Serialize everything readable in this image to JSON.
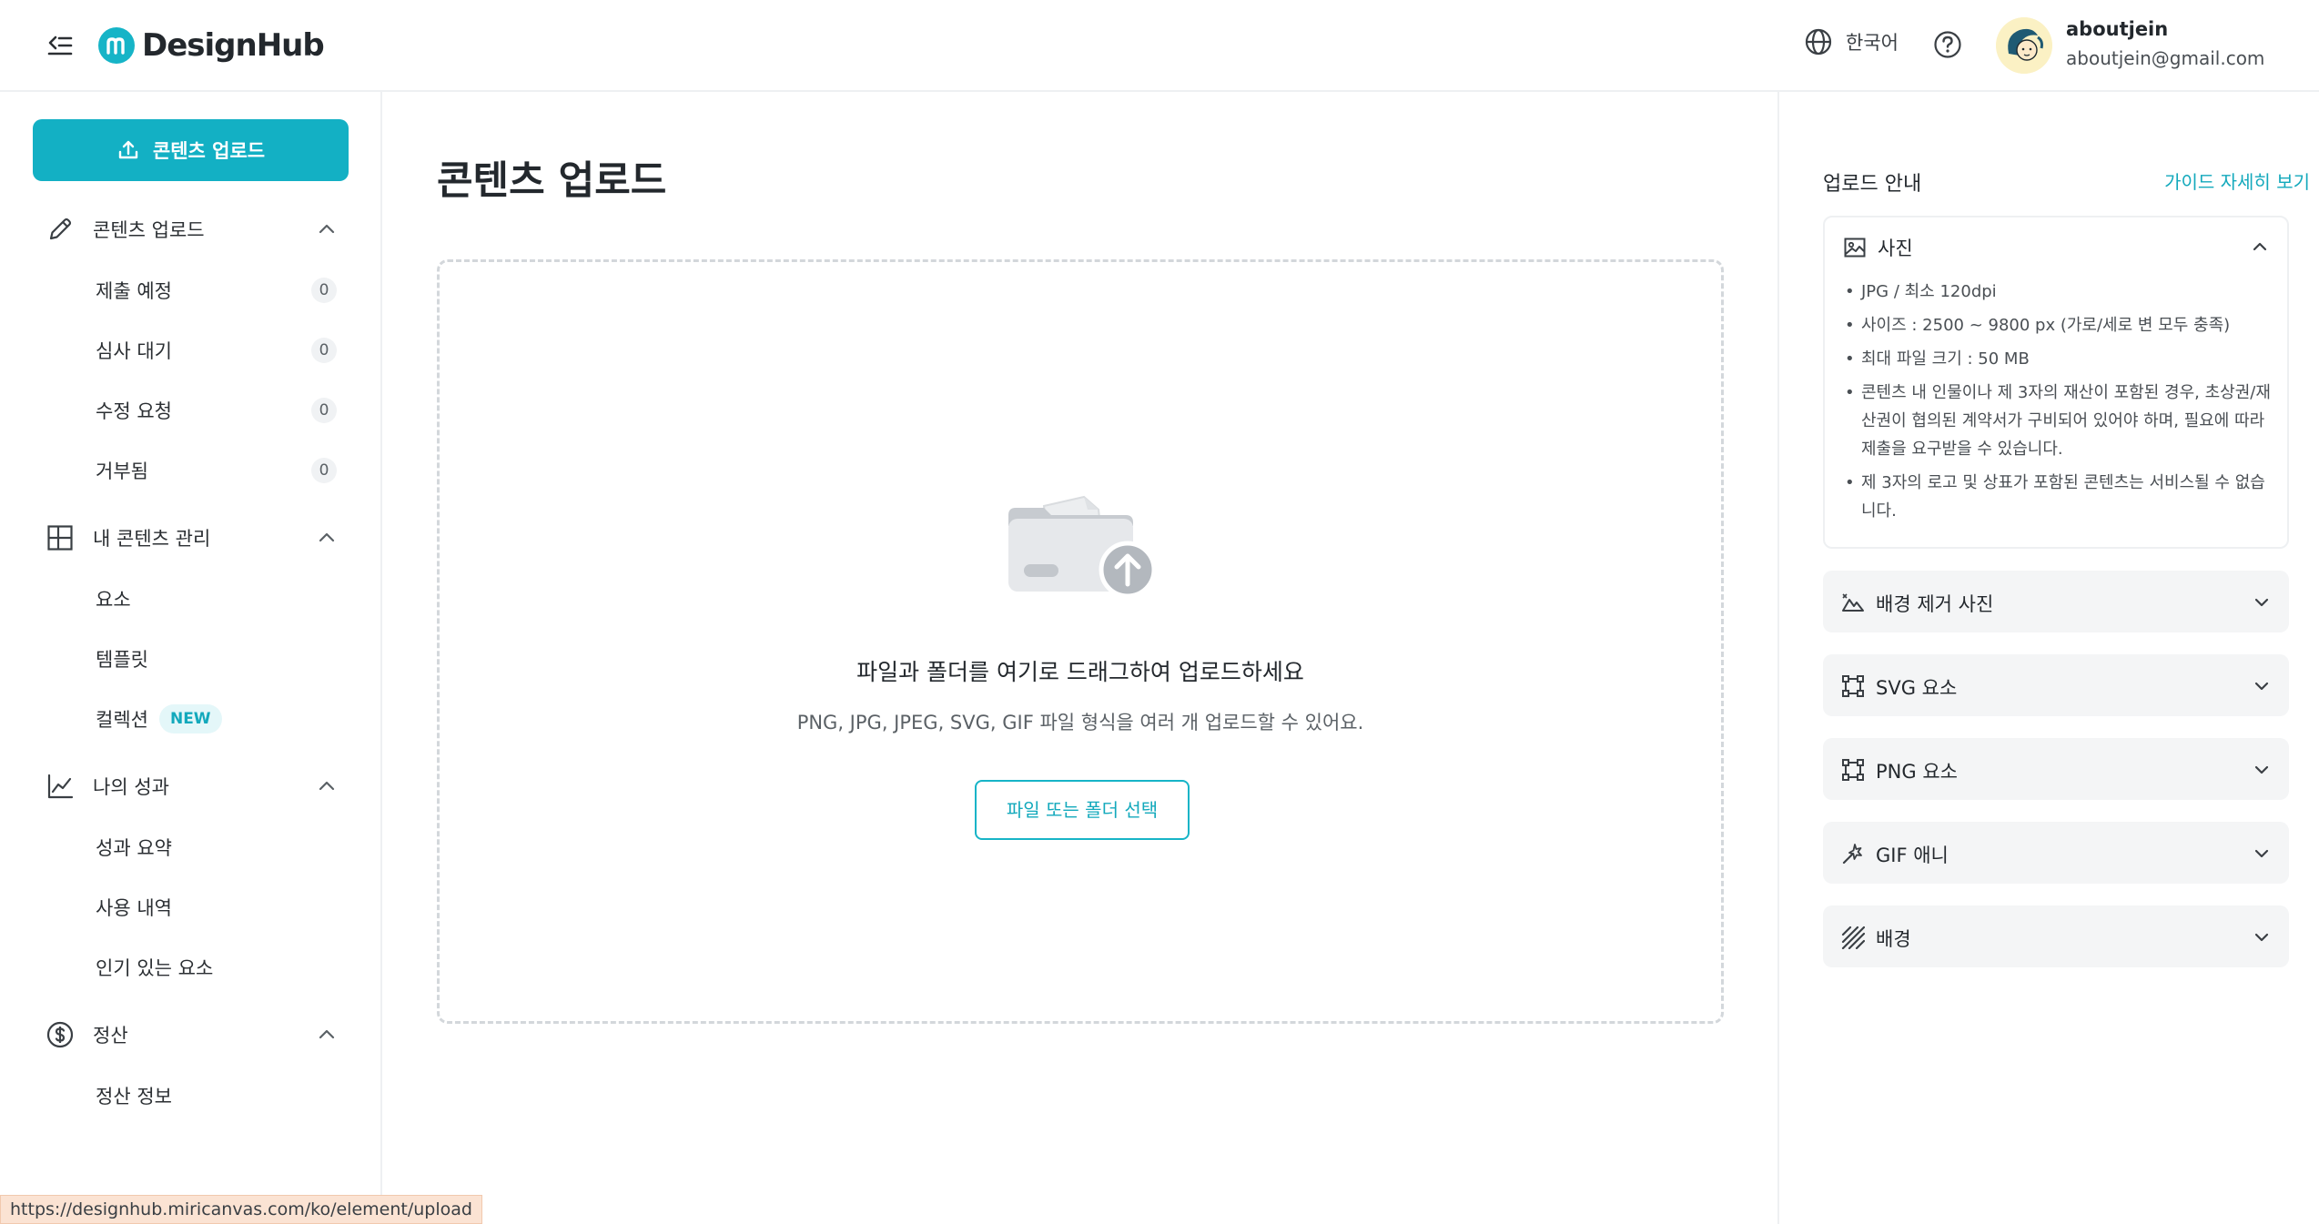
{
  "header": {
    "logo_text": "DesignHub",
    "language": "한국어",
    "user_name": "aboutjein",
    "user_email": "aboutjein@gmail.com"
  },
  "sidebar": {
    "upload_button": "콘텐츠 업로드",
    "sections": [
      {
        "label": "콘텐츠 업로드",
        "icon": "pencil-icon",
        "items": [
          {
            "label": "제출 예정",
            "count": "0"
          },
          {
            "label": "심사 대기",
            "count": "0"
          },
          {
            "label": "수정 요청",
            "count": "0"
          },
          {
            "label": "거부됨",
            "count": "0"
          }
        ]
      },
      {
        "label": "내 콘텐츠 관리",
        "icon": "layout-grid-icon",
        "items": [
          {
            "label": "요소"
          },
          {
            "label": "템플릿"
          },
          {
            "label": "컬렉션",
            "badge": "NEW"
          }
        ]
      },
      {
        "label": "나의 성과",
        "icon": "line-chart-icon",
        "items": [
          {
            "label": "성과 요약"
          },
          {
            "label": "사용 내역"
          },
          {
            "label": "인기 있는 요소"
          }
        ]
      },
      {
        "label": "정산",
        "icon": "coin-icon",
        "items": [
          {
            "label": "정산 정보"
          }
        ]
      }
    ]
  },
  "main": {
    "title": "콘텐츠 업로드",
    "drop_title": "파일과 폴더를 여기로 드래그하여 업로드하세요",
    "drop_subtitle": "PNG, JPG, JPEG, SVG, GIF 파일 형식을 여러 개 업로드할 수 있어요.",
    "select_button": "파일 또는 폴더 선택"
  },
  "guide": {
    "title": "업로드 안내",
    "link": "가이드 자세히 보기",
    "open_section": {
      "label": "사진",
      "icon": "image-icon",
      "bullets": [
        "JPG / 최소 120dpi",
        "사이즈 : 2500 ~ 9800 px (가로/세로 변 모두 충족)",
        "최대 파일 크기 : 50 MB",
        "콘텐츠 내 인물이나 제 3자의 재산이 포함된 경우, 초상권/재산권이 협의된 계약서가 구비되어 있어야 하며, 필요에 따라 제출을 요구받을 수 있습니다.",
        "제 3자의 로고 및 상표가 포함된 콘텐츠는 서비스될 수 없습니다."
      ]
    },
    "collapsed_sections": [
      {
        "label": "배경 제거 사진",
        "icon": "mountain-icon"
      },
      {
        "label": "SVG 요소",
        "icon": "vector-square-icon"
      },
      {
        "label": "PNG 요소",
        "icon": "vector-square-icon"
      },
      {
        "label": "GIF 애니",
        "icon": "magic-wand-icon"
      },
      {
        "label": "배경",
        "icon": "pattern-icon"
      }
    ]
  },
  "status_bar": {
    "url": "https://designhub.miricanvas.com/ko/element/upload"
  },
  "colors": {
    "accent": "#13b0c4",
    "border": "#eef0f2",
    "panel_bg": "#f4f5f6"
  }
}
